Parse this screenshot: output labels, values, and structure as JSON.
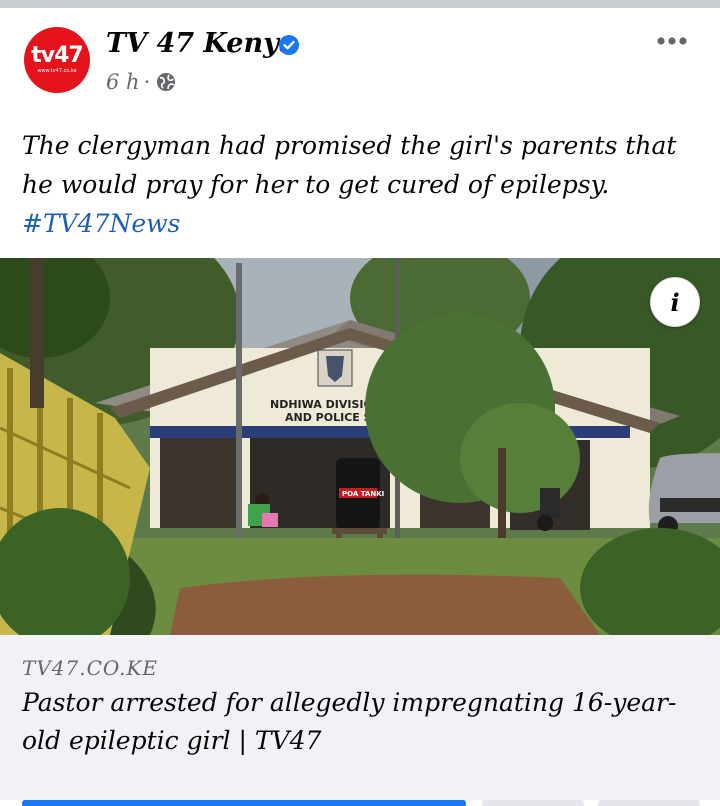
{
  "post": {
    "page_name": "TV 47 Kenya",
    "avatar_text": "tv47",
    "avatar_url_text": "www.tv47.co.ke",
    "time": "6 h",
    "separator": "·",
    "text_main": "The clergyman had promised the girl's parents that he would pray for her to get cured of epilepsy.",
    "hashtag": "#TV47News",
    "info_label": "i"
  },
  "photo": {
    "sign_line1": "NDHIWA DIVISIONAL H",
    "sign_line2": "AND POLICE S",
    "tank_label": "POA TANKI"
  },
  "link": {
    "domain": "TV47.CO.KE",
    "headline": "Pastor arrested for allegedly impregnating 16-year-old epileptic girl | TV47"
  },
  "icons": {
    "verified": "verified-badge-icon",
    "globe": "globe-icon",
    "more": "more-options-icon",
    "info": "info-icon"
  },
  "colors": {
    "brand_red": "#e3121b",
    "link_blue": "#1d5fb6",
    "verified_blue": "#1877f2",
    "card_bg": "#f0f2f5"
  }
}
